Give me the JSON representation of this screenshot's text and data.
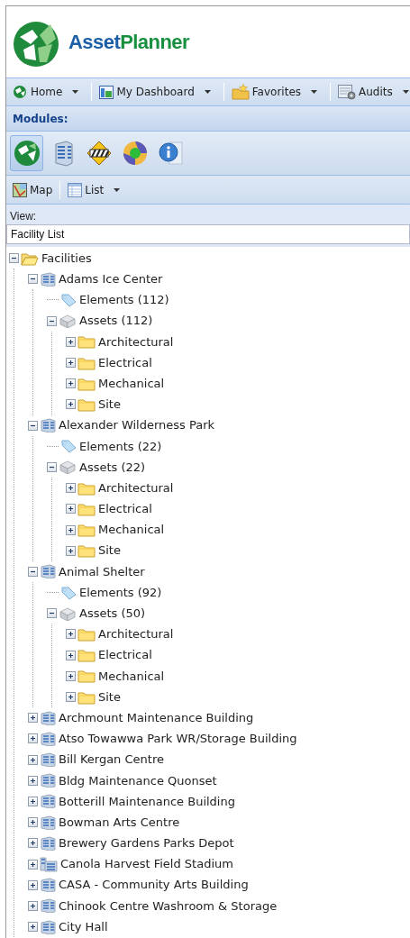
{
  "logo": {
    "text_parts": [
      "Asset",
      "Planner"
    ]
  },
  "main_toolbar": [
    {
      "label": "Home",
      "kind": "home",
      "dropdown": true
    },
    {
      "label": "My Dashboard",
      "kind": "dashboard",
      "dropdown": true
    },
    {
      "label": "Favorites",
      "kind": "favorites",
      "dropdown": true
    },
    {
      "label": "Audits",
      "kind": "audits",
      "dropdown": true
    }
  ],
  "modules": {
    "title": "Modules:",
    "items": [
      {
        "kind": "home",
        "selected": true
      },
      {
        "kind": "building",
        "selected": false
      },
      {
        "kind": "barrier",
        "selected": false
      },
      {
        "kind": "cycle",
        "selected": false
      },
      {
        "kind": "info",
        "selected": false
      }
    ]
  },
  "view_toolbar": [
    {
      "label": "Map",
      "kind": "map",
      "dropdown": false
    },
    {
      "label": "List",
      "kind": "list",
      "dropdown": true
    }
  ],
  "view": {
    "label": "View:",
    "value": "Facility List"
  },
  "tree": [
    {
      "label": "Facilities",
      "kind": "folder",
      "expanded": true,
      "children": [
        {
          "label": "Adams Ice Center",
          "kind": "facility",
          "expanded": true,
          "children": [
            {
              "label": "Elements (112)",
              "kind": "elements"
            },
            {
              "label": "Assets (112)",
              "kind": "assets",
              "expanded": true,
              "children": [
                {
                  "label": "Architectural",
                  "kind": "folder",
                  "expanded": false
                },
                {
                  "label": "Electrical",
                  "kind": "folder",
                  "expanded": false
                },
                {
                  "label": "Mechanical",
                  "kind": "folder",
                  "expanded": false
                },
                {
                  "label": "Site",
                  "kind": "folder",
                  "expanded": false
                }
              ]
            }
          ]
        },
        {
          "label": "Alexander Wilderness Park",
          "kind": "facility",
          "expanded": true,
          "children": [
            {
              "label": "Elements (22)",
              "kind": "elements"
            },
            {
              "label": "Assets (22)",
              "kind": "assets",
              "expanded": true,
              "children": [
                {
                  "label": "Architectural",
                  "kind": "folder",
                  "expanded": false
                },
                {
                  "label": "Electrical",
                  "kind": "folder",
                  "expanded": false
                },
                {
                  "label": "Mechanical",
                  "kind": "folder",
                  "expanded": false
                },
                {
                  "label": "Site",
                  "kind": "folder",
                  "expanded": false
                }
              ]
            }
          ]
        },
        {
          "label": "Animal Shelter",
          "kind": "facility",
          "expanded": true,
          "children": [
            {
              "label": "Elements (92)",
              "kind": "elements"
            },
            {
              "label": "Assets (50)",
              "kind": "assets",
              "expanded": true,
              "children": [
                {
                  "label": "Architectural",
                  "kind": "folder",
                  "expanded": false
                },
                {
                  "label": "Electrical",
                  "kind": "folder",
                  "expanded": false
                },
                {
                  "label": "Mechanical",
                  "kind": "folder",
                  "expanded": false
                },
                {
                  "label": "Site",
                  "kind": "folder",
                  "expanded": false
                }
              ]
            }
          ]
        },
        {
          "label": "Archmount Maintenance Building",
          "kind": "facility",
          "expanded": false
        },
        {
          "label": "Atso Towawwa Park WR/Storage Building",
          "kind": "facility",
          "expanded": false
        },
        {
          "label": "Bill Kergan Centre",
          "kind": "facility",
          "expanded": false
        },
        {
          "label": "Bldg Maintenance Quonset",
          "kind": "facility",
          "expanded": false
        },
        {
          "label": "Botterill Maintenance Building",
          "kind": "facility",
          "expanded": false
        },
        {
          "label": "Bowman Arts Centre",
          "kind": "facility",
          "expanded": false
        },
        {
          "label": "Brewery Gardens Parks Depot",
          "kind": "facility",
          "expanded": false
        },
        {
          "label": "Canola Harvest Field Stadium",
          "kind": "stadium",
          "expanded": false
        },
        {
          "label": "CASA - Community Arts Building",
          "kind": "facility",
          "expanded": false
        },
        {
          "label": "Chinook Centre Washroom & Storage",
          "kind": "facility",
          "expanded": false
        },
        {
          "label": "City Hall",
          "kind": "facility",
          "expanded": false
        }
      ]
    }
  ]
}
